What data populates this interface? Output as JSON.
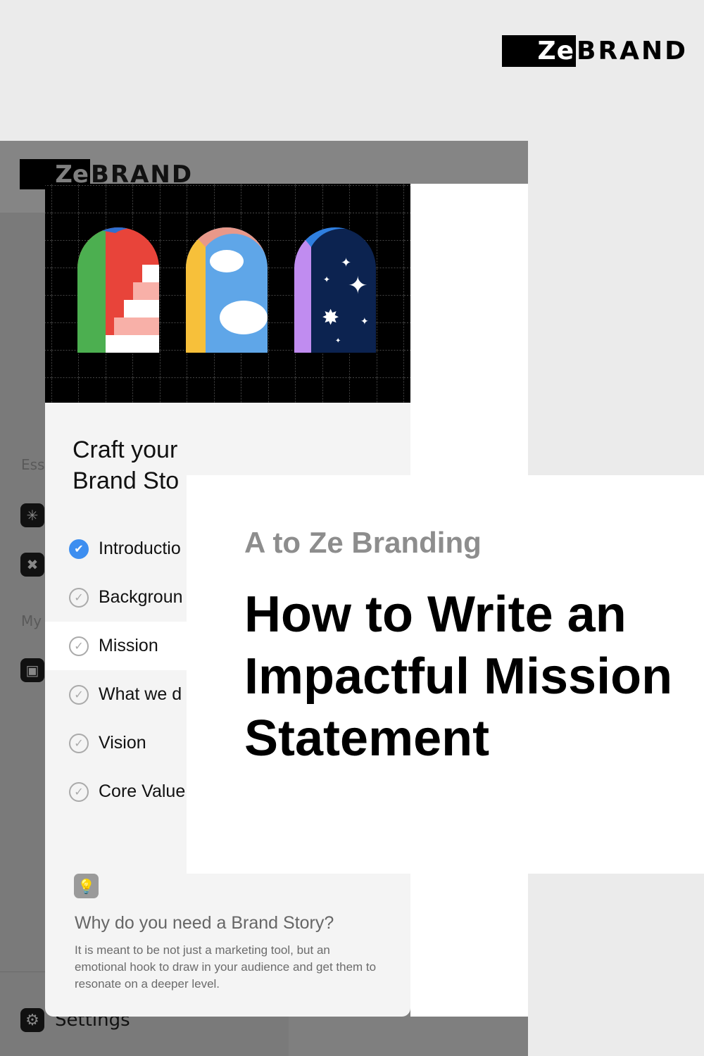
{
  "brand": {
    "ze": "Ze",
    "rest": "BRAND"
  },
  "app": {
    "sidebar_sections": [
      "Ess",
      "My"
    ],
    "settings_label": "Settings"
  },
  "card": {
    "title_line1": "Craft your",
    "title_line2": "Brand Sto",
    "checklist": [
      {
        "label": "Introductio",
        "done": true
      },
      {
        "label": "Backgroun",
        "done": false
      },
      {
        "label": "Mission",
        "done": false,
        "active": true
      },
      {
        "label": "What we d",
        "done": false
      },
      {
        "label": "Vision",
        "done": false
      },
      {
        "label": "Core Value",
        "done": false
      }
    ],
    "tip_title": "Why do you need a Brand Story?",
    "tip_body": "It is meant to be not just a marketing tool, but an emotional hook to draw in your audience and get them to resonate on a deeper level."
  },
  "overlay": {
    "eyebrow": "A to Ze Branding",
    "headline": "How to Write an Impactful Mission Statement"
  },
  "colors": {
    "check_done": "#3d8ef0",
    "background": "#ebebeb",
    "overlay_bg": "#ffffff"
  },
  "icons": [
    "lightbulb-icon",
    "settings-gear-icon",
    "sparkle-icon",
    "tools-icon",
    "calendar-icon",
    "checkmark-icon"
  ]
}
